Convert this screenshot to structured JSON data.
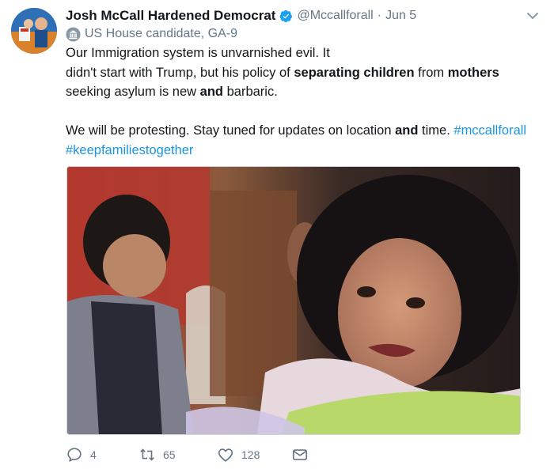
{
  "user": {
    "display_name": "Josh McCall Hardened Democrat",
    "handle": "@Mccallforall",
    "separator": "·",
    "date": "Jun 5"
  },
  "label": {
    "icon": "government-building-icon",
    "text": "US House candidate, GA-9"
  },
  "tweet": {
    "line1": "Our Immigration system is unvarnished evil. It",
    "line2_a": "didn't start with Trump, but his policy of ",
    "line2_b": "separating children",
    "line2_c": " from ",
    "line2_d": "mothers",
    "line3_a": "seeking asylum is new ",
    "line3_b": "and",
    "line3_c": " barbaric.",
    "line4_a": "We will be protesting. Stay tuned for updates on location ",
    "line4_b": "and",
    "line4_c": " time. ",
    "hashtag1": "#mccallforall",
    "hashtag2": "#keepfamiliestogether"
  },
  "media": {
    "description_icon": "photo-crying-child"
  },
  "actions": {
    "reply_count": "4",
    "retweet_count": "65",
    "like_count": "128"
  },
  "colors": {
    "link": "#1b95e0",
    "secondary_text": "#657786",
    "verified": "#1da1f2"
  }
}
